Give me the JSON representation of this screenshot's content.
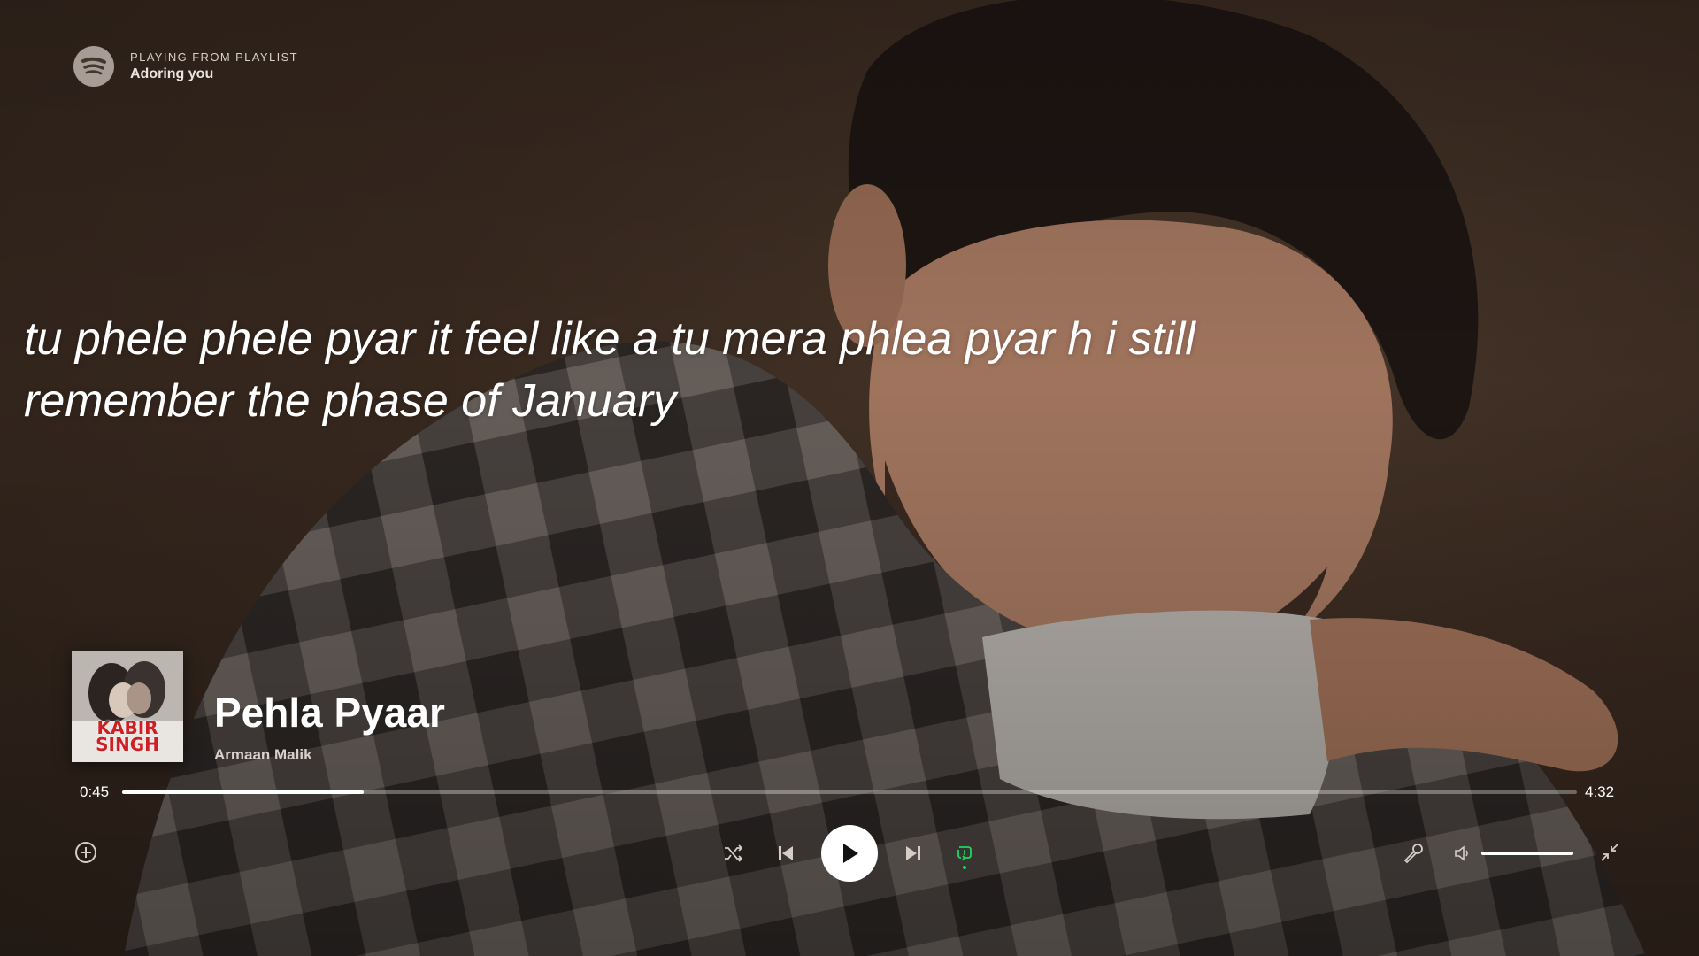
{
  "header": {
    "context_label": "PLAYING FROM PLAYLIST",
    "playlist_name": "Adoring you",
    "logo_icon": "spotify-logo-icon"
  },
  "lyrics": {
    "current_line": "tu phele phele pyar it feel like a tu mera phlea pyar h i still remember the phase of January"
  },
  "now_playing": {
    "title": "Pehla Pyaar",
    "artist": "Armaan Malik",
    "cover_text": "KABIR SINGH"
  },
  "progress": {
    "elapsed": "0:45",
    "total": "4:32",
    "fraction": 0.166
  },
  "volume": {
    "fraction": 1.0
  },
  "controls": {
    "add_icon": "add-circle-icon",
    "shuffle_icon": "shuffle-icon",
    "previous_icon": "skip-previous-icon",
    "play_icon": "play-icon",
    "next_icon": "skip-next-icon",
    "repeat_icon": "repeat-one-icon",
    "lyrics_icon": "microphone-icon",
    "volume_icon": "volume-icon",
    "exit_fullscreen_icon": "minimize-icon"
  },
  "colors": {
    "background": "#3b2c22",
    "accent": "#1ed760",
    "text": "#ffffff",
    "album_text": "#cf1f24"
  }
}
